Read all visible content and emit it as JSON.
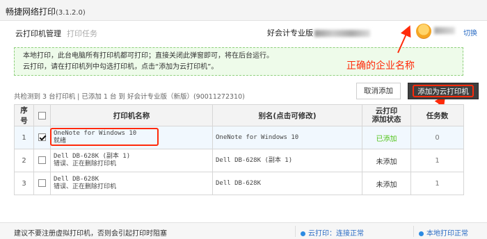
{
  "window": {
    "title": "畅捷网络打印",
    "version": "(3.1.2.0)"
  },
  "nav": {
    "tabs": [
      {
        "label": "云打印机管理"
      },
      {
        "label": "打印任务"
      }
    ],
    "company": "好会计专业版",
    "switch_label": "切换"
  },
  "notice": {
    "line1": "本地打印，此台电脑所有打印机都可打印；直接关闭此弹窗即可，将在后台运行。",
    "line2": "云打印，请在打印机列中勾选打印机，点击“添加为云打印机”。"
  },
  "annotation": {
    "label": "正确的企业名称"
  },
  "summary": "共检测到 3 台打印机 | 已添加 1 台 到 好会计专业版（新版）(90011272310)",
  "buttons": {
    "cancel": "取消添加",
    "add": "添加为云打印机"
  },
  "table": {
    "headers": {
      "index": "序号",
      "name": "打印机名称",
      "alias": "别名(点击可修改)",
      "status_line1": "云打印",
      "status_line2": "添加状态",
      "count": "任务数"
    },
    "rows": [
      {
        "index": "1",
        "checked": true,
        "name": "OneNote for Windows 10",
        "state": "就绪",
        "alias": "OneNote for Windows 10",
        "status": "已添加",
        "count": "0"
      },
      {
        "index": "2",
        "checked": false,
        "name": "Dell DB-628K (副本 1)",
        "state": "错误、正在删除打印机",
        "alias": "Dell DB-628K (副本 1)",
        "status": "未添加",
        "count": "1"
      },
      {
        "index": "3",
        "checked": false,
        "name": "Dell DB-628K",
        "state": "错误、正在删除打印机",
        "alias": "Dell DB-628K",
        "status": "未添加",
        "count": "1"
      }
    ]
  },
  "footer": {
    "tip": "建议不要注册虚拟打印机，否则会引起打印时阻塞",
    "cloud_status": "云打印：连接正常",
    "local_status": "本地打印正常"
  },
  "colors": {
    "accent": "#2b6cc4",
    "annotation": "#ff2a0a",
    "ok": "#52c41a"
  }
}
